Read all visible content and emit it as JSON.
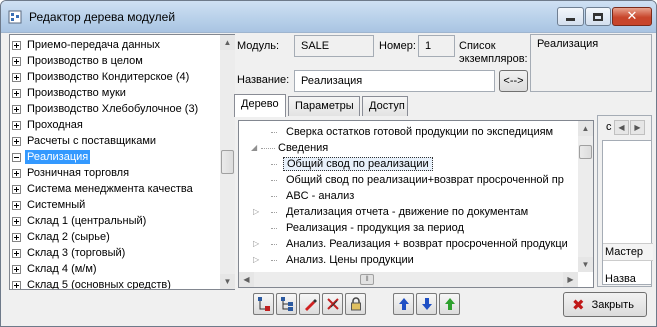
{
  "window": {
    "title": "Редактор дерева модулей"
  },
  "left_tree": {
    "items": [
      {
        "label": "Приемо-передача данных",
        "expander": "plus"
      },
      {
        "label": "Производство в целом",
        "expander": "plus"
      },
      {
        "label": "Производство Кондитерское (4)",
        "expander": "plus"
      },
      {
        "label": "Производство муки",
        "expander": "plus"
      },
      {
        "label": "Производство Хлебобулочное (3)",
        "expander": "plus"
      },
      {
        "label": "Проходная",
        "expander": "plus"
      },
      {
        "label": "Расчеты с поставщиками",
        "expander": "plus"
      },
      {
        "label": "Реализация",
        "expander": "minus",
        "selected": true
      },
      {
        "label": "Розничная торговля",
        "expander": "plus"
      },
      {
        "label": "Система менеджмента качества",
        "expander": "plus"
      },
      {
        "label": "Системный",
        "expander": "plus"
      },
      {
        "label": "Склад 1 (центральный)",
        "expander": "plus"
      },
      {
        "label": "Склад 2 (сырье)",
        "expander": "plus"
      },
      {
        "label": "Склад 3 (торговый)",
        "expander": "plus"
      },
      {
        "label": "Склад 4 (м/м)",
        "expander": "plus"
      },
      {
        "label": "Склад 5 (основных средств)",
        "expander": "plus"
      }
    ]
  },
  "header": {
    "module_label": "Модуль:",
    "module_value": "SALE",
    "number_label": "Номер:",
    "number_value": "1",
    "instances_label": "Список экземпляров:",
    "instances_value": "Реализация",
    "name_label": "Название:",
    "name_value": "Реализация",
    "swap_button": "<-->"
  },
  "tabs": [
    {
      "label": "Дерево",
      "active": true
    },
    {
      "label": "Параметры",
      "active": false
    },
    {
      "label": "Доступ",
      "active": false
    }
  ],
  "right_tree": {
    "items": [
      {
        "label": "Сверка остатков готовой продукции по экспедициям",
        "level": 1,
        "expander": "none"
      },
      {
        "label": "Сведения",
        "level": 0,
        "expander": "expanded"
      },
      {
        "label": "Общий свод по реализации",
        "level": 1,
        "expander": "none",
        "focused": true
      },
      {
        "label": "Общий свод по реализации+возврат просроченной пр",
        "level": 1,
        "expander": "none"
      },
      {
        "label": "ABC - анализ",
        "level": 1,
        "expander": "none"
      },
      {
        "label": "Детализация отчета - движение по документам",
        "level": 1,
        "expander": "collapsed"
      },
      {
        "label": "Реализация - продукция за период",
        "level": 1,
        "expander": "none"
      },
      {
        "label": "Анализ. Реализация + возврат просроченной продукци",
        "level": 1,
        "expander": "collapsed"
      },
      {
        "label": "Анализ. Цены продукции",
        "level": 1,
        "expander": "collapsed"
      }
    ]
  },
  "side_panel": {
    "tab_label": "с",
    "header_label": "Мастер",
    "cell_label": "Назва"
  },
  "bottom_toolbar": {
    "icons": [
      "add-node-icon",
      "add-child-node-icon",
      "edit-node-icon",
      "delete-node-icon",
      "lock-icon",
      "move-up-icon",
      "move-down-icon",
      "move-level-up-icon"
    ],
    "close_label": "Закрыть"
  }
}
